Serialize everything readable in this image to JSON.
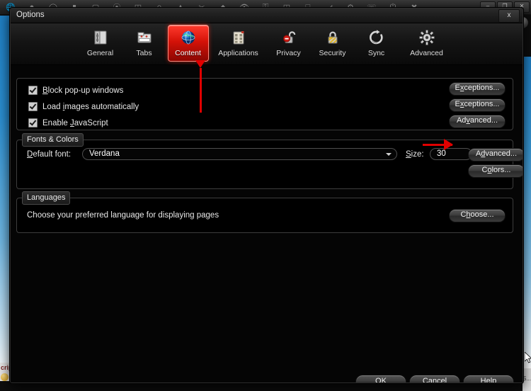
{
  "desktop": {
    "topbar_icons": [
      "globe-icon",
      "disc-icon",
      "sphere-icon",
      "box-icon",
      "door-icon",
      "swirl-icon",
      "cabinet-icon",
      "ball-icon",
      "paint-icon",
      "scissors-icon",
      "diamond-icon",
      "eye-icon",
      "key-icon",
      "battery-icon",
      "window-icon",
      "cart-icon",
      "gear-icon",
      "phone-icon",
      "power-icon",
      "close-icon"
    ],
    "window_buttons": [
      "minimize-glyph",
      "restore-glyph",
      "close-glyph"
    ],
    "window_button_labels": [
      "–",
      "❐",
      "✕"
    ],
    "page_left_text": "crip",
    "page_right_text": "S..."
  },
  "window": {
    "title": "Options",
    "close_label": "x"
  },
  "tabs": [
    {
      "label": "General",
      "icon": "general-panel-icon",
      "selected": false
    },
    {
      "label": "Tabs",
      "icon": "browser-tabs-icon",
      "selected": false
    },
    {
      "label": "Content",
      "icon": "globe-icon",
      "selected": true
    },
    {
      "label": "Applications",
      "icon": "applications-grid-icon",
      "selected": false
    },
    {
      "label": "Privacy",
      "icon": "unlocked-padlock-icon",
      "selected": false
    },
    {
      "label": "Security",
      "icon": "locked-padlock-icon",
      "selected": false
    },
    {
      "label": "Sync",
      "icon": "sync-arrows-icon",
      "selected": false
    },
    {
      "label": "Advanced",
      "icon": "gear-icon",
      "selected": false
    }
  ],
  "content": {
    "checkboxes": [
      {
        "label_pre": "",
        "accel": "B",
        "label_post": "lock pop-up windows",
        "checked": true
      },
      {
        "label_pre": "Load ",
        "accel": "i",
        "label_post": "mages automatically",
        "checked": true
      },
      {
        "label_pre": "Enable ",
        "accel": "J",
        "label_post": "avaScript",
        "checked": true
      }
    ],
    "buttons": [
      {
        "pre": "E",
        "accel": "x",
        "post": "ceptions..."
      },
      {
        "pre": "E",
        "accel": "x",
        "post": "ceptions..."
      },
      {
        "pre": "Ad",
        "accel": "v",
        "post": "anced..."
      }
    ],
    "fonts_group": {
      "title": "Fonts & Colors",
      "default_font_label_accel": "D",
      "default_font_label_post": "efault font:",
      "default_font_value": "Verdana",
      "size_label_accel": "S",
      "size_label_post": "ize:",
      "size_value": "30",
      "advanced_button": {
        "pre": "A",
        "accel": "d",
        "post": "vanced..."
      },
      "colors_button": {
        "pre": "C",
        "accel": "o",
        "post": "lors..."
      }
    },
    "languages_group": {
      "title": "Languages",
      "description": "Choose your preferred language for displaying pages",
      "choose_button": {
        "pre": "C",
        "accel": "h",
        "post": "oose..."
      }
    }
  },
  "footer_buttons": [
    {
      "pre": "",
      "accel": "O",
      "post": "K"
    },
    {
      "pre": "",
      "accel": "C",
      "post": "ancel"
    },
    {
      "pre": "",
      "accel": "H",
      "post": "elp"
    }
  ],
  "annotations": [
    {
      "name": "arrow-to-content-tab",
      "direction": "up"
    },
    {
      "name": "arrow-to-advanced-font-button",
      "direction": "right"
    }
  ],
  "colors": {
    "selected_tab_red": "#d41208",
    "annotation_red": "#e00000",
    "dialog_bg": "#050505",
    "text": "#e8e8e8"
  }
}
